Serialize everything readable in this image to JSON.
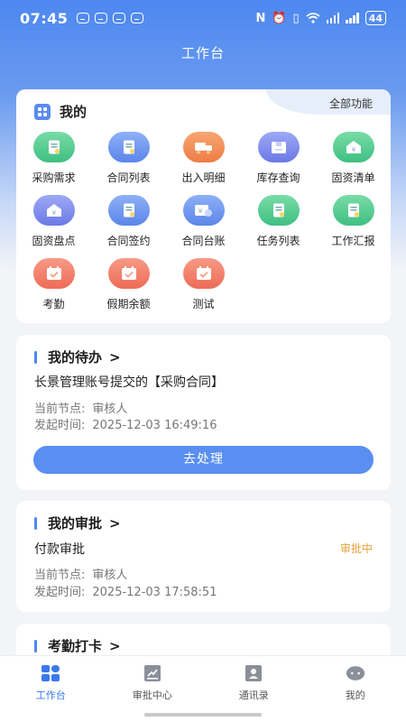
{
  "status_bar": {
    "time": "07:45",
    "battery": "44"
  },
  "header": {
    "title": "工作台"
  },
  "my_section": {
    "title": "我的",
    "all_functions": "全部功能",
    "items": [
      [
        {
          "label": "采购需求",
          "icon": "purchase-doc-icon",
          "color": "green"
        },
        {
          "label": "合同列表",
          "icon": "contract-list-icon",
          "color": "blue"
        },
        {
          "label": "出入明细",
          "icon": "inout-detail-icon",
          "color": "orange"
        },
        {
          "label": "库存查询",
          "icon": "inventory-box-icon",
          "color": "purple"
        },
        {
          "label": "固资清单",
          "icon": "fixed-asset-house-icon",
          "color": "green"
        }
      ],
      [
        {
          "label": "固资盘点",
          "icon": "asset-check-house-icon",
          "color": "purple"
        },
        {
          "label": "合同签约",
          "icon": "contract-sign-icon",
          "color": "blue"
        },
        {
          "label": "合同台账",
          "icon": "contract-ledger-icon",
          "color": "blue"
        },
        {
          "label": "任务列表",
          "icon": "task-list-icon",
          "color": "green"
        },
        {
          "label": "工作汇报",
          "icon": "work-report-icon",
          "color": "green"
        }
      ],
      [
        {
          "label": "考勤",
          "icon": "attendance-calendar-icon",
          "color": "red"
        },
        {
          "label": "假期余额",
          "icon": "leave-balance-calendar-icon",
          "color": "red"
        },
        {
          "label": "测试",
          "icon": "test-calendar-icon",
          "color": "red"
        }
      ]
    ]
  },
  "todo": {
    "title": "我的待办",
    "arrow": ">",
    "item_title": "长景管理账号提交的【采购合同】",
    "node_label": "当前节点:",
    "node_value": "审核人",
    "time_label": "发起时间:",
    "time_value": "2025-12-03 16:49:16",
    "button": "去处理"
  },
  "approval": {
    "title": "我的审批",
    "arrow": ">",
    "item_title": "付款审批",
    "status": "审批中",
    "node_label": "当前节点:",
    "node_value": "审核人",
    "time_label": "发起时间:",
    "time_value": "2025-12-03 17:58:51"
  },
  "attendance": {
    "title": "考勤打卡",
    "arrow": ">"
  },
  "tabbar": [
    {
      "label": "工作台",
      "icon": "workbench-icon",
      "active": true
    },
    {
      "label": "审批中心",
      "icon": "approval-center-icon",
      "active": false
    },
    {
      "label": "通讯录",
      "icon": "contacts-icon",
      "active": false
    },
    {
      "label": "我的",
      "icon": "profile-chat-icon",
      "active": false
    }
  ],
  "colors": {
    "primary": "#4d87ef",
    "status_pending": "#e6a23c",
    "green": "#3fbf82",
    "blue": "#5b86ea",
    "orange": "#ee7c45",
    "purple": "#6b79e6",
    "red": "#ee6b56"
  }
}
